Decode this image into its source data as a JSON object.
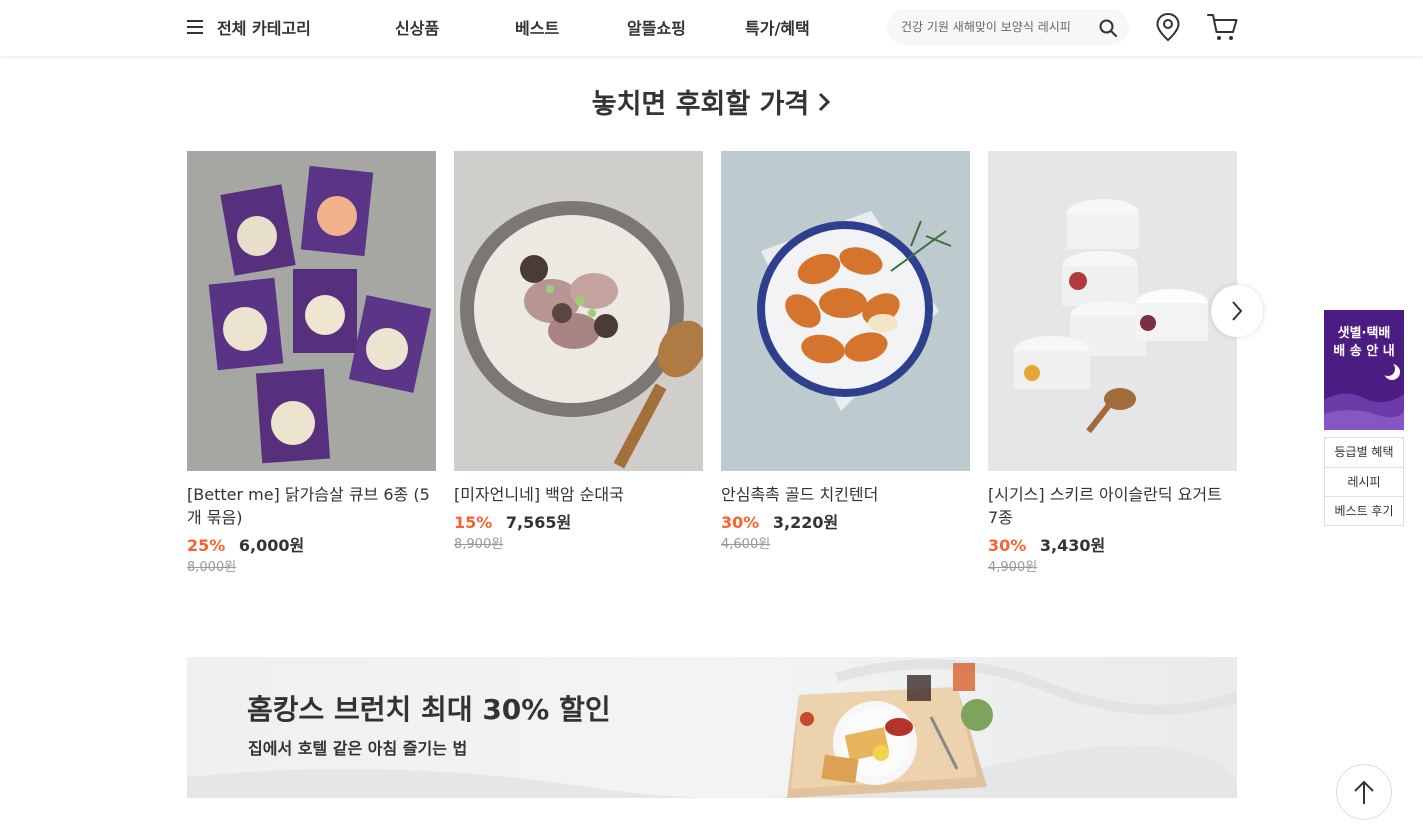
{
  "header": {
    "category_label": "전체 카테고리",
    "nav": [
      "신상품",
      "베스트",
      "알뜰쇼핑",
      "특가/혜택"
    ],
    "search_placeholder": "건강 기원 새해맞이 보양식 레시피"
  },
  "section": {
    "title": "놓치면 후회할 가격"
  },
  "products": [
    {
      "name": "[Better me] 닭가슴살 큐브 6종 (5개 묶음)",
      "discount": "25%",
      "price": "6,000원",
      "original": "8,000원"
    },
    {
      "name": "[미자언니네] 백암 순대국",
      "discount": "15%",
      "price": "7,565원",
      "original": "8,900원"
    },
    {
      "name": "안심촉촉 골드 치킨텐더",
      "discount": "30%",
      "price": "3,220원",
      "original": "4,600원"
    },
    {
      "name": "[시기스] 스키르 아이슬란딕 요거트 7종",
      "discount": "30%",
      "price": "3,430원",
      "original": "4,900원"
    }
  ],
  "banner": {
    "title": "홈캉스 브런치 최대 30% 할인",
    "subtitle": "집에서 호텔 같은 아침 즐기는 법"
  },
  "side": {
    "banner_line1": "샛별·택배",
    "banner_line2": "배 송 안 내",
    "menu": [
      "등급별 혜택",
      "레시피",
      "베스트 후기"
    ]
  },
  "colors": {
    "accent": "#fa622f",
    "side_banner": "#4b1d83"
  }
}
